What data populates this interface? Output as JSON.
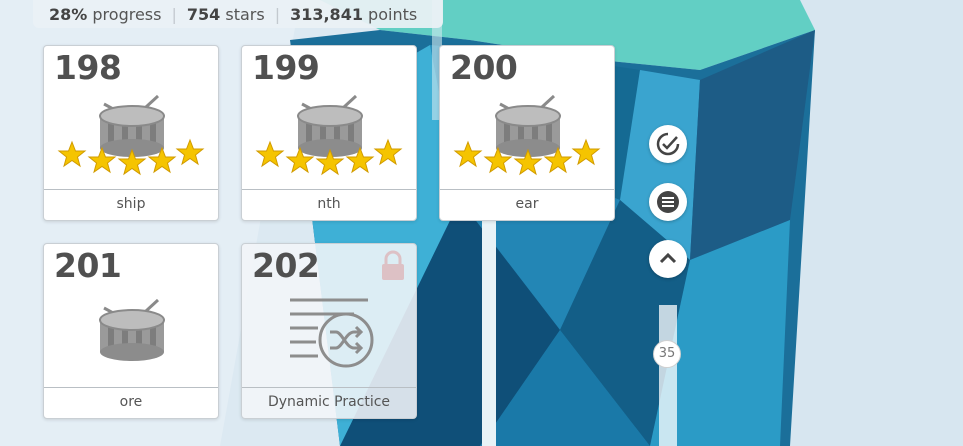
{
  "stats": {
    "progress_value": "28%",
    "progress_label": "progress",
    "stars_value": "754",
    "stars_label": "stars",
    "points_value": "313,841",
    "points_label": "points"
  },
  "lessons": [
    {
      "number": "198",
      "word": "ship",
      "stars": 5,
      "icon": "drum-icon"
    },
    {
      "number": "199",
      "word": "nth",
      "stars": 5,
      "icon": "drum-icon"
    },
    {
      "number": "200",
      "word": "ear",
      "stars": 5,
      "icon": "drum-icon"
    },
    {
      "number": "201",
      "word": "ore",
      "stars": 0,
      "icon": "drum-icon"
    },
    {
      "number": "202",
      "word": "Dynamic Practice",
      "locked": true,
      "icon": "shuffle-list-icon"
    }
  ],
  "side_buttons": [
    {
      "icon": "check-badge-icon"
    },
    {
      "icon": "menu-icon"
    },
    {
      "icon": "chevron-up-icon"
    }
  ],
  "slider": {
    "value": "35"
  },
  "colors": {
    "accent": "#2f8fc0",
    "star": "#f5c400",
    "text": "#505050"
  }
}
